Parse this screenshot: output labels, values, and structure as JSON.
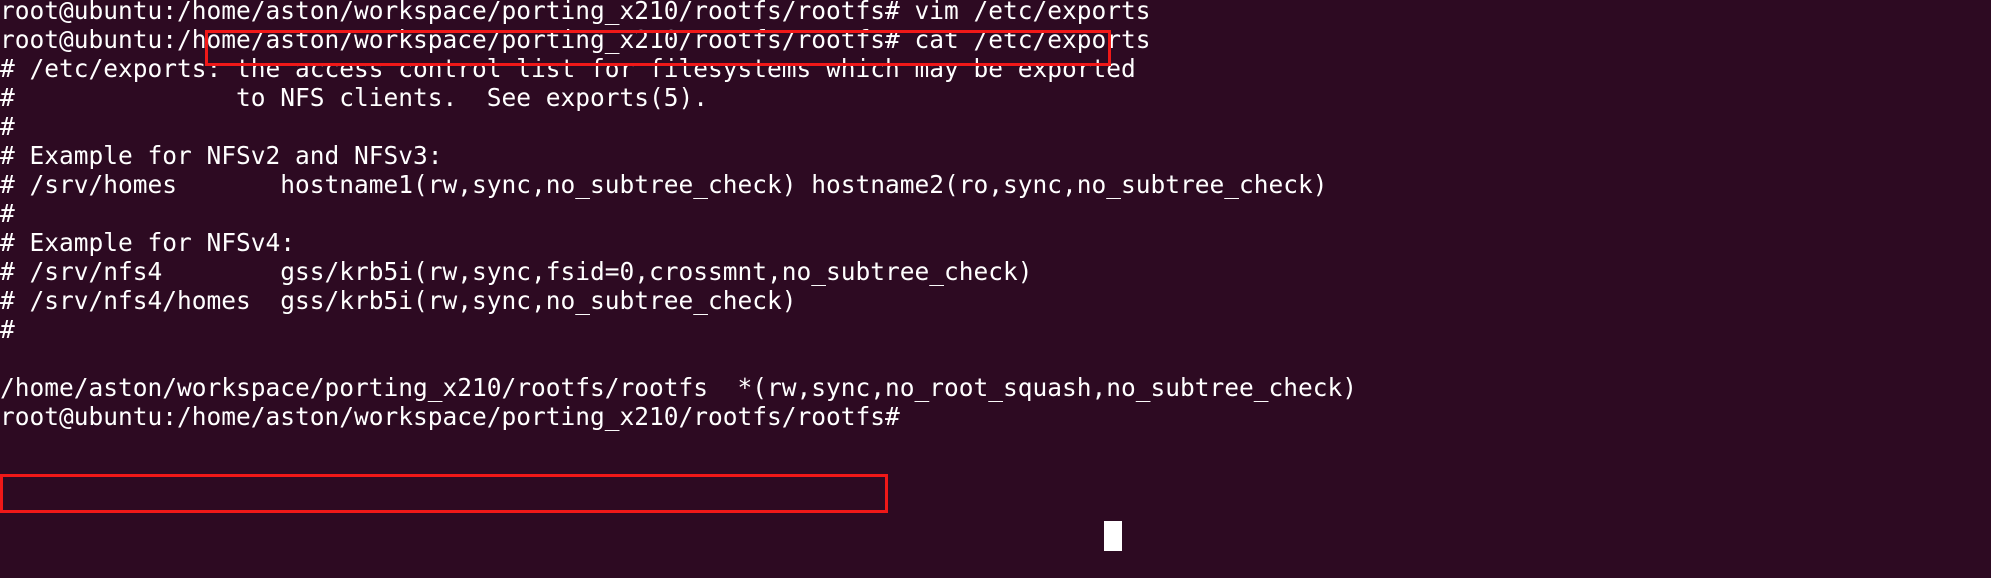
{
  "terminal": {
    "background_color": "#2d0a22",
    "foreground_color": "#ffffff",
    "annotation_color": "#f01818",
    "cursor": "█",
    "lines": [
      "root@ubuntu:/home/aston/workspace/porting_x210/rootfs/rootfs# vim /etc/exports",
      "root@ubuntu:/home/aston/workspace/porting_x210/rootfs/rootfs# cat /etc/exports",
      "# /etc/exports: the access control list for filesystems which may be exported",
      "#               to NFS clients.  See exports(5).",
      "#",
      "# Example for NFSv2 and NFSv3:",
      "# /srv/homes       hostname1(rw,sync,no_subtree_check) hostname2(ro,sync,no_subtree_check)",
      "#",
      "# Example for NFSv4:",
      "# /srv/nfs4        gss/krb5i(rw,sync,fsid=0,crossmnt,no_subtree_check)",
      "# /srv/nfs4/homes  gss/krb5i(rw,sync,no_subtree_check)",
      "#",
      "",
      "/home/aston/workspace/porting_x210/rootfs/rootfs  *(rw,sync,no_root_squash,no_subtree_check)",
      "root@ubuntu:/home/aston/workspace/porting_x210/rootfs/rootfs# "
    ]
  },
  "annotations": {
    "prompt_path_box": {
      "label": "highlighted-prompt-working-directory",
      "text": ":/home/aston/workspace/porting_x210/rootfs/rootfs#"
    },
    "export_path_box": {
      "label": "highlighted-export-path",
      "text": "/home/aston/workspace/porting_x210/rootfs/rootfs"
    }
  }
}
